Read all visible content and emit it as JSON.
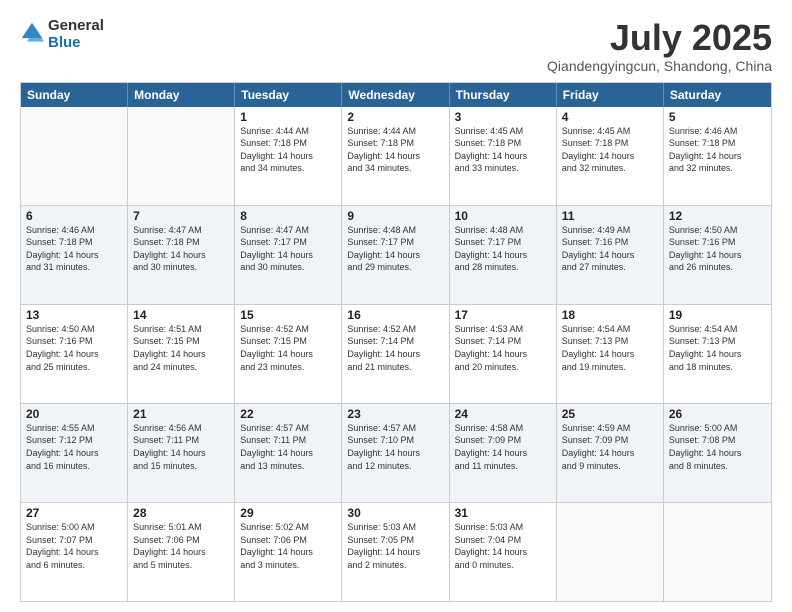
{
  "logo": {
    "general": "General",
    "blue": "Blue"
  },
  "title": "July 2025",
  "location": "Qiandengyingcun, Shandong, China",
  "header_days": [
    "Sunday",
    "Monday",
    "Tuesday",
    "Wednesday",
    "Thursday",
    "Friday",
    "Saturday"
  ],
  "weeks": [
    [
      {
        "day": "",
        "info": ""
      },
      {
        "day": "",
        "info": ""
      },
      {
        "day": "1",
        "info": "Sunrise: 4:44 AM\nSunset: 7:18 PM\nDaylight: 14 hours\nand 34 minutes."
      },
      {
        "day": "2",
        "info": "Sunrise: 4:44 AM\nSunset: 7:18 PM\nDaylight: 14 hours\nand 34 minutes."
      },
      {
        "day": "3",
        "info": "Sunrise: 4:45 AM\nSunset: 7:18 PM\nDaylight: 14 hours\nand 33 minutes."
      },
      {
        "day": "4",
        "info": "Sunrise: 4:45 AM\nSunset: 7:18 PM\nDaylight: 14 hours\nand 32 minutes."
      },
      {
        "day": "5",
        "info": "Sunrise: 4:46 AM\nSunset: 7:18 PM\nDaylight: 14 hours\nand 32 minutes."
      }
    ],
    [
      {
        "day": "6",
        "info": "Sunrise: 4:46 AM\nSunset: 7:18 PM\nDaylight: 14 hours\nand 31 minutes."
      },
      {
        "day": "7",
        "info": "Sunrise: 4:47 AM\nSunset: 7:18 PM\nDaylight: 14 hours\nand 30 minutes."
      },
      {
        "day": "8",
        "info": "Sunrise: 4:47 AM\nSunset: 7:17 PM\nDaylight: 14 hours\nand 30 minutes."
      },
      {
        "day": "9",
        "info": "Sunrise: 4:48 AM\nSunset: 7:17 PM\nDaylight: 14 hours\nand 29 minutes."
      },
      {
        "day": "10",
        "info": "Sunrise: 4:48 AM\nSunset: 7:17 PM\nDaylight: 14 hours\nand 28 minutes."
      },
      {
        "day": "11",
        "info": "Sunrise: 4:49 AM\nSunset: 7:16 PM\nDaylight: 14 hours\nand 27 minutes."
      },
      {
        "day": "12",
        "info": "Sunrise: 4:50 AM\nSunset: 7:16 PM\nDaylight: 14 hours\nand 26 minutes."
      }
    ],
    [
      {
        "day": "13",
        "info": "Sunrise: 4:50 AM\nSunset: 7:16 PM\nDaylight: 14 hours\nand 25 minutes."
      },
      {
        "day": "14",
        "info": "Sunrise: 4:51 AM\nSunset: 7:15 PM\nDaylight: 14 hours\nand 24 minutes."
      },
      {
        "day": "15",
        "info": "Sunrise: 4:52 AM\nSunset: 7:15 PM\nDaylight: 14 hours\nand 23 minutes."
      },
      {
        "day": "16",
        "info": "Sunrise: 4:52 AM\nSunset: 7:14 PM\nDaylight: 14 hours\nand 21 minutes."
      },
      {
        "day": "17",
        "info": "Sunrise: 4:53 AM\nSunset: 7:14 PM\nDaylight: 14 hours\nand 20 minutes."
      },
      {
        "day": "18",
        "info": "Sunrise: 4:54 AM\nSunset: 7:13 PM\nDaylight: 14 hours\nand 19 minutes."
      },
      {
        "day": "19",
        "info": "Sunrise: 4:54 AM\nSunset: 7:13 PM\nDaylight: 14 hours\nand 18 minutes."
      }
    ],
    [
      {
        "day": "20",
        "info": "Sunrise: 4:55 AM\nSunset: 7:12 PM\nDaylight: 14 hours\nand 16 minutes."
      },
      {
        "day": "21",
        "info": "Sunrise: 4:56 AM\nSunset: 7:11 PM\nDaylight: 14 hours\nand 15 minutes."
      },
      {
        "day": "22",
        "info": "Sunrise: 4:57 AM\nSunset: 7:11 PM\nDaylight: 14 hours\nand 13 minutes."
      },
      {
        "day": "23",
        "info": "Sunrise: 4:57 AM\nSunset: 7:10 PM\nDaylight: 14 hours\nand 12 minutes."
      },
      {
        "day": "24",
        "info": "Sunrise: 4:58 AM\nSunset: 7:09 PM\nDaylight: 14 hours\nand 11 minutes."
      },
      {
        "day": "25",
        "info": "Sunrise: 4:59 AM\nSunset: 7:09 PM\nDaylight: 14 hours\nand 9 minutes."
      },
      {
        "day": "26",
        "info": "Sunrise: 5:00 AM\nSunset: 7:08 PM\nDaylight: 14 hours\nand 8 minutes."
      }
    ],
    [
      {
        "day": "27",
        "info": "Sunrise: 5:00 AM\nSunset: 7:07 PM\nDaylight: 14 hours\nand 6 minutes."
      },
      {
        "day": "28",
        "info": "Sunrise: 5:01 AM\nSunset: 7:06 PM\nDaylight: 14 hours\nand 5 minutes."
      },
      {
        "day": "29",
        "info": "Sunrise: 5:02 AM\nSunset: 7:06 PM\nDaylight: 14 hours\nand 3 minutes."
      },
      {
        "day": "30",
        "info": "Sunrise: 5:03 AM\nSunset: 7:05 PM\nDaylight: 14 hours\nand 2 minutes."
      },
      {
        "day": "31",
        "info": "Sunrise: 5:03 AM\nSunset: 7:04 PM\nDaylight: 14 hours\nand 0 minutes."
      },
      {
        "day": "",
        "info": ""
      },
      {
        "day": "",
        "info": ""
      }
    ]
  ]
}
